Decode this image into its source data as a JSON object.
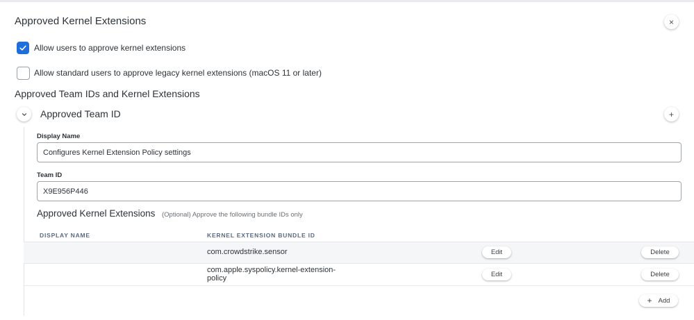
{
  "panel": {
    "title": "Approved Kernel Extensions",
    "close_icon": "×"
  },
  "options": {
    "allow_users_approve": {
      "label": "Allow users to approve kernel extensions",
      "checked": true
    },
    "allow_standard_users_legacy": {
      "label": "Allow standard users to approve legacy kernel extensions (macOS 11 or later)",
      "checked": false
    }
  },
  "section": {
    "title": "Approved Team IDs and Kernel Extensions"
  },
  "team": {
    "title": "Approved Team ID",
    "collapse_icon": "⌄",
    "add_icon": "+",
    "display_name_label": "Display Name",
    "display_name_value": "Configures Kernel Extension Policy settings",
    "team_id_label": "Team ID",
    "team_id_value": "X9E956P446"
  },
  "kext": {
    "title": "Approved Kernel Extensions",
    "hint": "(Optional) Approve the following bundle IDs only",
    "columns": [
      "DISPLAY NAME",
      "KERNEL EXTENSION BUNDLE ID"
    ],
    "rows": [
      {
        "display_name": "",
        "bundle_id_line1": "com.crowdstrike.sensor",
        "bundle_id_line2": "",
        "edit": "Edit",
        "delete": "Delete"
      },
      {
        "display_name": "",
        "bundle_id_line1": "com.apple.syspolicy.kernel-extension-",
        "bundle_id_line2": "policy",
        "edit": "Edit",
        "delete": "Delete"
      }
    ],
    "add_icon": "+",
    "add_label": "Add"
  },
  "colors": {
    "accent": "#1e6fd9",
    "row_shade": "#f5f6f8",
    "header_text": "#5a6a80"
  }
}
